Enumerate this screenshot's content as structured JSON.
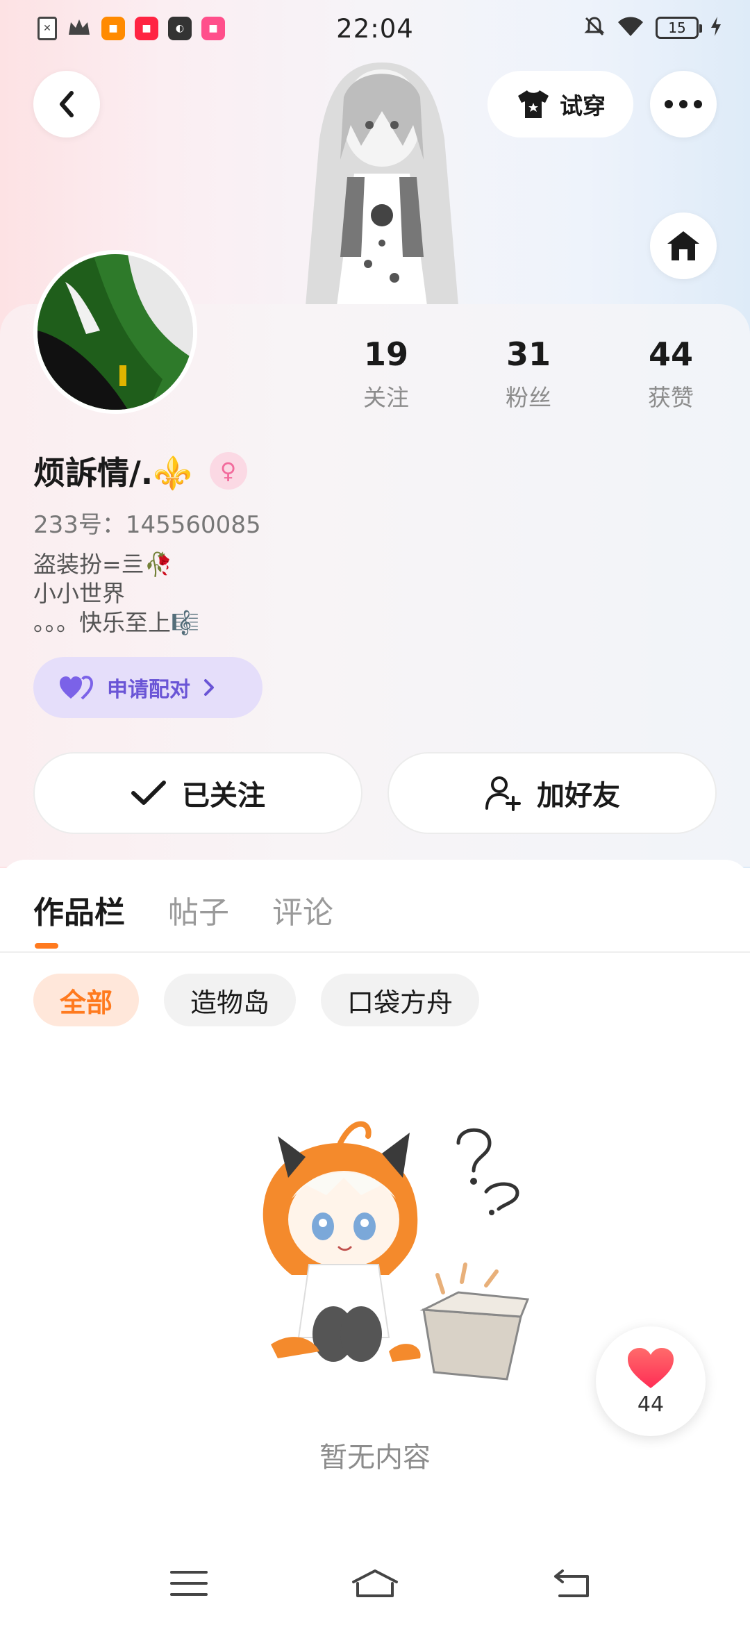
{
  "status_bar": {
    "time": "22:04",
    "battery": "15",
    "left_icons": [
      "sim-icon",
      "crown-icon",
      "app-icon-orange",
      "app-icon-red",
      "app-icon-dark",
      "app-icon-pink"
    ],
    "right_icons": [
      "mute-bell-icon",
      "wifi-icon",
      "battery-icon",
      "charging-icon"
    ]
  },
  "header": {
    "tryon_label": "试穿"
  },
  "profile": {
    "nickname": "烦訴情/.⚜️",
    "uid": "233号：145560085",
    "bio": [
      "盗装扮=亖🥀",
      "小小世界",
      "。。。快乐至上🎼"
    ],
    "pair_label": "申请配对",
    "stats": [
      {
        "value": "19",
        "label": "关注"
      },
      {
        "value": "31",
        "label": "粉丝"
      },
      {
        "value": "44",
        "label": "获赞"
      }
    ],
    "followed_label": "已关注",
    "add_friend_label": "加好友"
  },
  "content": {
    "tabs": [
      "作品栏",
      "帖子",
      "评论"
    ],
    "active_tab": 0,
    "chips": [
      "全部",
      "造物岛",
      "口袋方舟"
    ],
    "active_chip": 0,
    "empty_text": "暂无内容"
  },
  "likes_fab": {
    "count": "44"
  },
  "colors": {
    "accent": "#ff7a1f",
    "pair_purple": "#6a55d6",
    "heart_red": "#ff3b4f"
  }
}
